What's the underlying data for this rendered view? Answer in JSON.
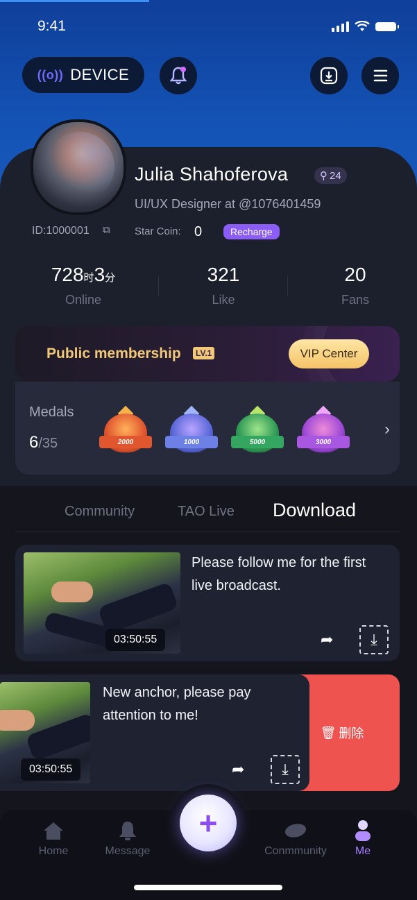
{
  "status_bar": {
    "time": "9:41"
  },
  "topbar": {
    "device_label": "DEVICE"
  },
  "profile": {
    "name": "Julia Shahoferova",
    "level": "24",
    "subtitle": "UI/UX Designer at @1076401459",
    "id_text": "ID:1000001",
    "star_coin_label": "Star Coin:",
    "star_coin_value": "0",
    "recharge_label": "Recharge"
  },
  "stats": [
    {
      "value_main": "728",
      "value_unit1": "时",
      "value_mid": "3",
      "value_unit2": "分",
      "label": "Online"
    },
    {
      "value_main": "321",
      "label": "Like"
    },
    {
      "value_main": "20",
      "label": "Fans"
    }
  ],
  "membership": {
    "title": "Public membership",
    "level_badge": "LV.1",
    "vip_button": "VIP Center"
  },
  "medals": {
    "label": "Medals",
    "count_owned": "6",
    "count_total": "/35",
    "items": [
      {
        "num": "2000",
        "color": "#e0562f"
      },
      {
        "num": "1000",
        "color": "#5a68d8"
      },
      {
        "num": "5000",
        "color": "#2f9a57"
      },
      {
        "num": "3000",
        "color": "#9c48d6"
      }
    ]
  },
  "tabs": [
    {
      "label": "Community"
    },
    {
      "label": "TAO Live"
    },
    {
      "label": "Download",
      "active": true
    }
  ],
  "downloads": [
    {
      "title_line1": "Please follow me for the first",
      "title_line2": "live broadcast.",
      "duration": "03:50:55"
    },
    {
      "title_line1": "New anchor, please pay",
      "title_line2": "attention to me!",
      "duration": "03:50:55",
      "delete_label": "删除"
    }
  ],
  "bottom_nav": [
    {
      "label": "Home"
    },
    {
      "label": "Message"
    },
    {
      "label": "Conmmunity"
    },
    {
      "label": "Me",
      "active": true
    }
  ],
  "colors": {
    "accent": "#8b5cf6",
    "gold": "#f1c877",
    "delete": "#ef5350"
  }
}
